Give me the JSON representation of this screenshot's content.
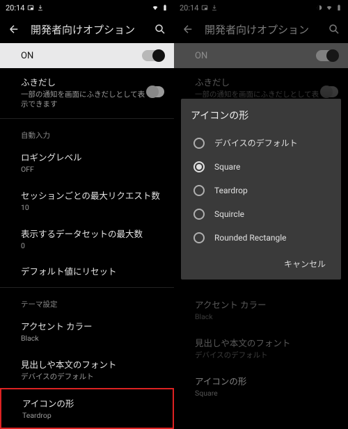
{
  "status": {
    "time": "20:14"
  },
  "appbar": {
    "title": "開発者向けオプション"
  },
  "on_row": {
    "label": "ON"
  },
  "fukidashi": {
    "title": "ふきだし",
    "desc": "一部の通知を画面にふきだしとして表示できます"
  },
  "autofill_section": "自動入力",
  "logging": {
    "title": "ロギングレベル",
    "value": "OFF"
  },
  "max_req": {
    "title": "セッションごとの最大リクエスト数",
    "value": "10"
  },
  "max_dataset": {
    "title": "表示するデータセットの最大数",
    "value": "0"
  },
  "reset": {
    "title": "デフォルト値にリセット"
  },
  "theme_section": "テーマ設定",
  "accent": {
    "title": "アクセント カラー",
    "value": "Black"
  },
  "font": {
    "title": "見出しや本文のフォント",
    "value": "デバイスのデフォルト"
  },
  "icon_shape_left": {
    "title": "アイコンの形",
    "value": "Teardrop"
  },
  "icon_shape_right": {
    "title": "アイコンの形",
    "value": "Square"
  },
  "dialog": {
    "title": "アイコンの形",
    "options": {
      "o0": "デバイスのデフォルト",
      "o1": "Square",
      "o2": "Teardrop",
      "o3": "Squircle",
      "o4": "Rounded Rectangle"
    },
    "cancel": "キャンセル"
  }
}
